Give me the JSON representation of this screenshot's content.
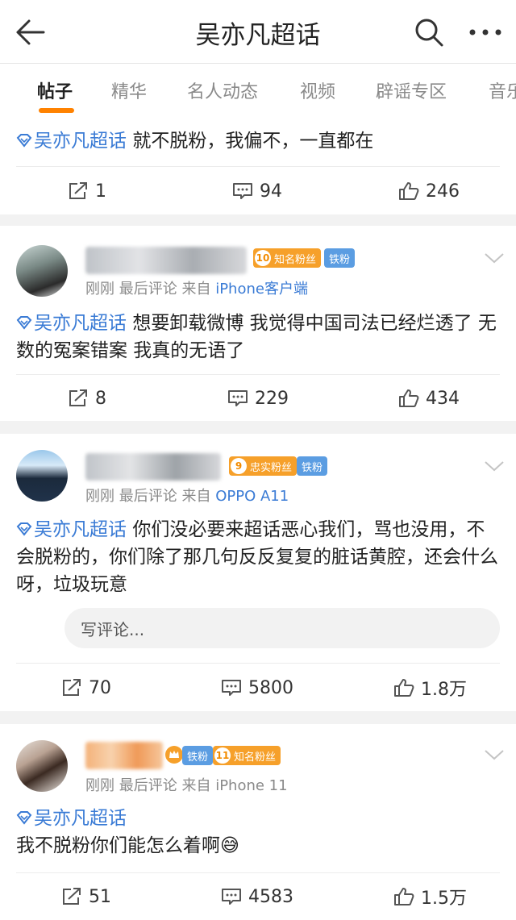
{
  "header": {
    "title": "吴亦凡超话"
  },
  "tabs": [
    {
      "label": "帖子"
    },
    {
      "label": "精华"
    },
    {
      "label": "名人动态"
    },
    {
      "label": "视频"
    },
    {
      "label": "辟谣专区"
    },
    {
      "label": "音乐"
    }
  ],
  "posts": [
    {
      "tag": "吴亦凡超话",
      "text": "就不脱粉，我偏不，一直都在",
      "reposts": "1",
      "comments": "94",
      "likes": "246"
    },
    {
      "badges": {
        "level": "10",
        "title": "知名粉丝",
        "iron": "铁粉"
      },
      "time": "刚刚 最后评论",
      "source_prefix": "来自",
      "source": "iPhone客户端",
      "tag": "吴亦凡超话",
      "text": "想要卸载微博 我觉得中国司法已经烂透了 无数的冤案错案  我真的无语了",
      "reposts": "8",
      "comments": "229",
      "likes": "434"
    },
    {
      "badges": {
        "level": "9",
        "title": "忠实粉丝",
        "iron": "铁粉"
      },
      "time": "刚刚 最后评论",
      "source_prefix": "来自",
      "source": "OPPO A11",
      "tag": "吴亦凡超话",
      "text": "你们没必要来超话恶心我们，骂也没用，不会脱粉的，你们除了那几句反反复复的脏话黄腔，还会什么呀，垃圾玩意",
      "comment_placeholder": "写评论...",
      "reposts": "70",
      "comments": "5800",
      "likes": "1.8万"
    },
    {
      "badges": {
        "level": "11",
        "title": "知名粉丝",
        "iron": "铁粉"
      },
      "time": "刚刚 最后评论",
      "source_prefix": "来自",
      "source": "iPhone 11",
      "tag": "吴亦凡超话",
      "text": "我不脱粉你们能怎么着啊",
      "emoji": "😅",
      "reposts": "51",
      "comments": "4583",
      "likes": "1.5万"
    }
  ]
}
